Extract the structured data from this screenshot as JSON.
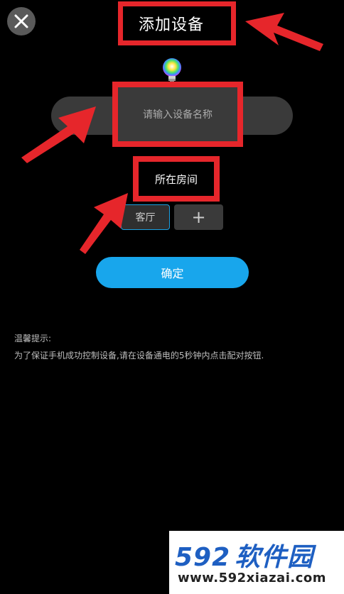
{
  "header": {
    "title": "添加设备",
    "close_icon": "close-icon"
  },
  "device": {
    "icon": "color-bulb-icon",
    "name_placeholder": "请输入设备名称"
  },
  "room": {
    "label": "所在房间",
    "options": [
      "客厅"
    ],
    "selected": "客厅",
    "add_label": "+"
  },
  "actions": {
    "confirm_label": "确定"
  },
  "tip": {
    "title": "温馨提示:",
    "text": "为了保证手机成功控制设备,请在设备通电的5秒钟内点击配对按钮."
  },
  "watermark": {
    "brand_num": "592",
    "brand_cn": "软件园",
    "url": "www.592xiazai.com"
  },
  "colors": {
    "background": "#000000",
    "accent": "#18a6ec",
    "annotation": "#e6262b",
    "input": "#3a3a3a"
  }
}
